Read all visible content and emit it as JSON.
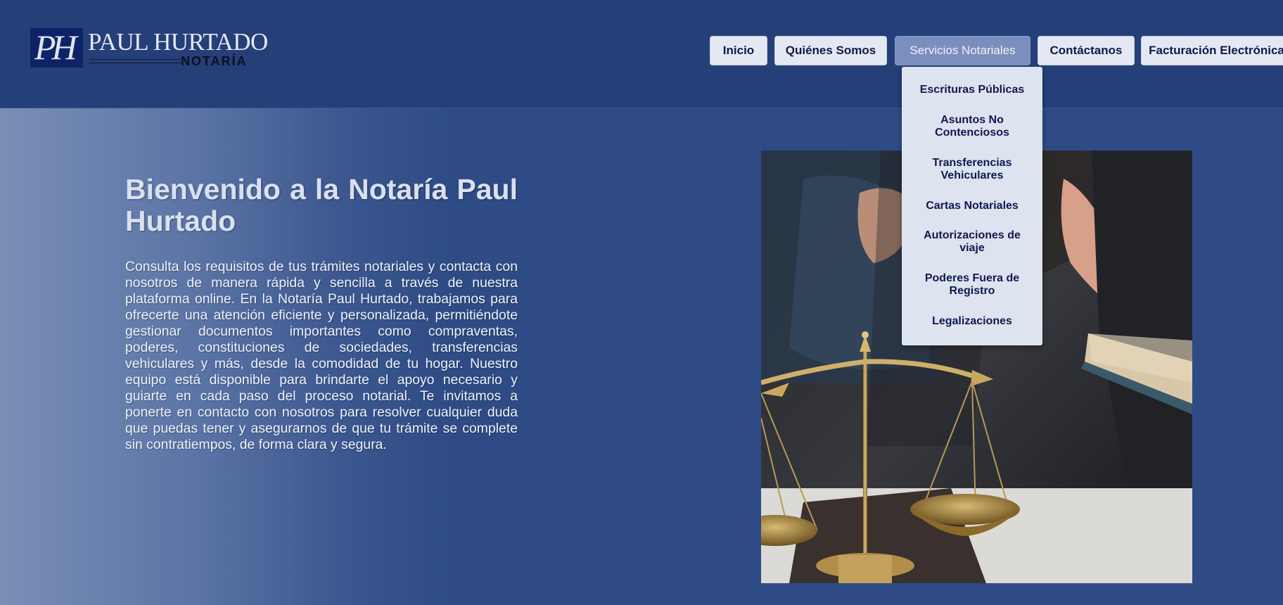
{
  "brand": {
    "monogram": "PH",
    "name": "PAUL HURTADO",
    "subtitle": "NOTARÍA"
  },
  "nav": {
    "items": [
      {
        "label": "Inicio"
      },
      {
        "label": "Quiénes Somos"
      },
      {
        "label": "Servicios Notariales",
        "active": true
      },
      {
        "label": "Contáctanos"
      },
      {
        "label": "Facturación Electrónica"
      }
    ],
    "dropdown": [
      "Escrituras Públicas",
      "Asuntos No Contenciosos",
      "Transferencias Vehiculares",
      "Cartas Notariales",
      "Autorizaciones de viaje",
      "Poderes Fuera de Registro",
      "Legalizaciones"
    ]
  },
  "hero": {
    "title": "Bienvenido a la Notaría Paul Hurtado",
    "body": "Consulta los requisitos de tus trámites notariales y contacta con nosotros de manera rápida y sencilla a través de nuestra plataforma online. En la Notaría Paul Hurtado, trabajamos para ofrecerte una atención eficiente y personalizada, permitiéndote gestionar documentos importantes como compraventas, poderes, constituciones de sociedades, transferencias vehiculares y más, desde la comodidad de tu hogar. Nuestro equipo está disponible para brindarte el apoyo necesario y guiarte en cada paso del proceso notarial. Te invitamos a ponerte en contacto con nosotros para resolver cualquier duda que puedas tener y asegurarnos de que tu trámite se complete sin contratiempos, de forma clara y segura."
  },
  "colors": {
    "header_bg": "#253f78",
    "page_bg": "#2e4b85",
    "nav_button_bg": "#e4e8f2",
    "nav_active_bg": "#7b8fbe",
    "dropdown_bg": "#dde3ef",
    "text_dark_navy": "#0e1a4a"
  }
}
